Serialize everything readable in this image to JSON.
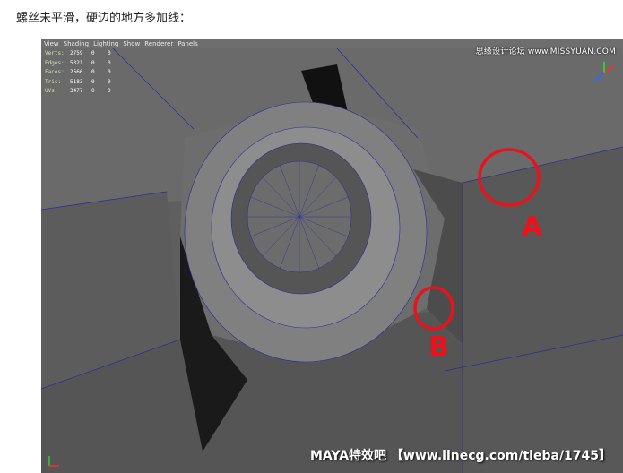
{
  "caption": "螺丝未平滑，硬边的地方多加线：",
  "menu": [
    "View",
    "Shading",
    "Lighting",
    "Show",
    "Renderer",
    "Panels"
  ],
  "hud": [
    {
      "label": "Verts:",
      "a": "2759",
      "b": "0",
      "c": "0"
    },
    {
      "label": "Edges:",
      "a": "5321",
      "b": "0",
      "c": "0"
    },
    {
      "label": "Faces:",
      "a": "2666",
      "b": "0",
      "c": "0"
    },
    {
      "label": "Tris:",
      "a": "5183",
      "b": "0",
      "c": "0"
    },
    {
      "label": "UVs:",
      "a": "3477",
      "b": "0",
      "c": "0"
    }
  ],
  "watermark_top": "思缘设计论坛 www.MISSYUAN.COM",
  "watermark_bottom": "MAYA特效吧  【www.linecg.com/tieba/1745】",
  "annotations": {
    "a": "A",
    "b": "B"
  },
  "colors": {
    "mark": "#e8131c",
    "wire": "#2a2a9a"
  }
}
